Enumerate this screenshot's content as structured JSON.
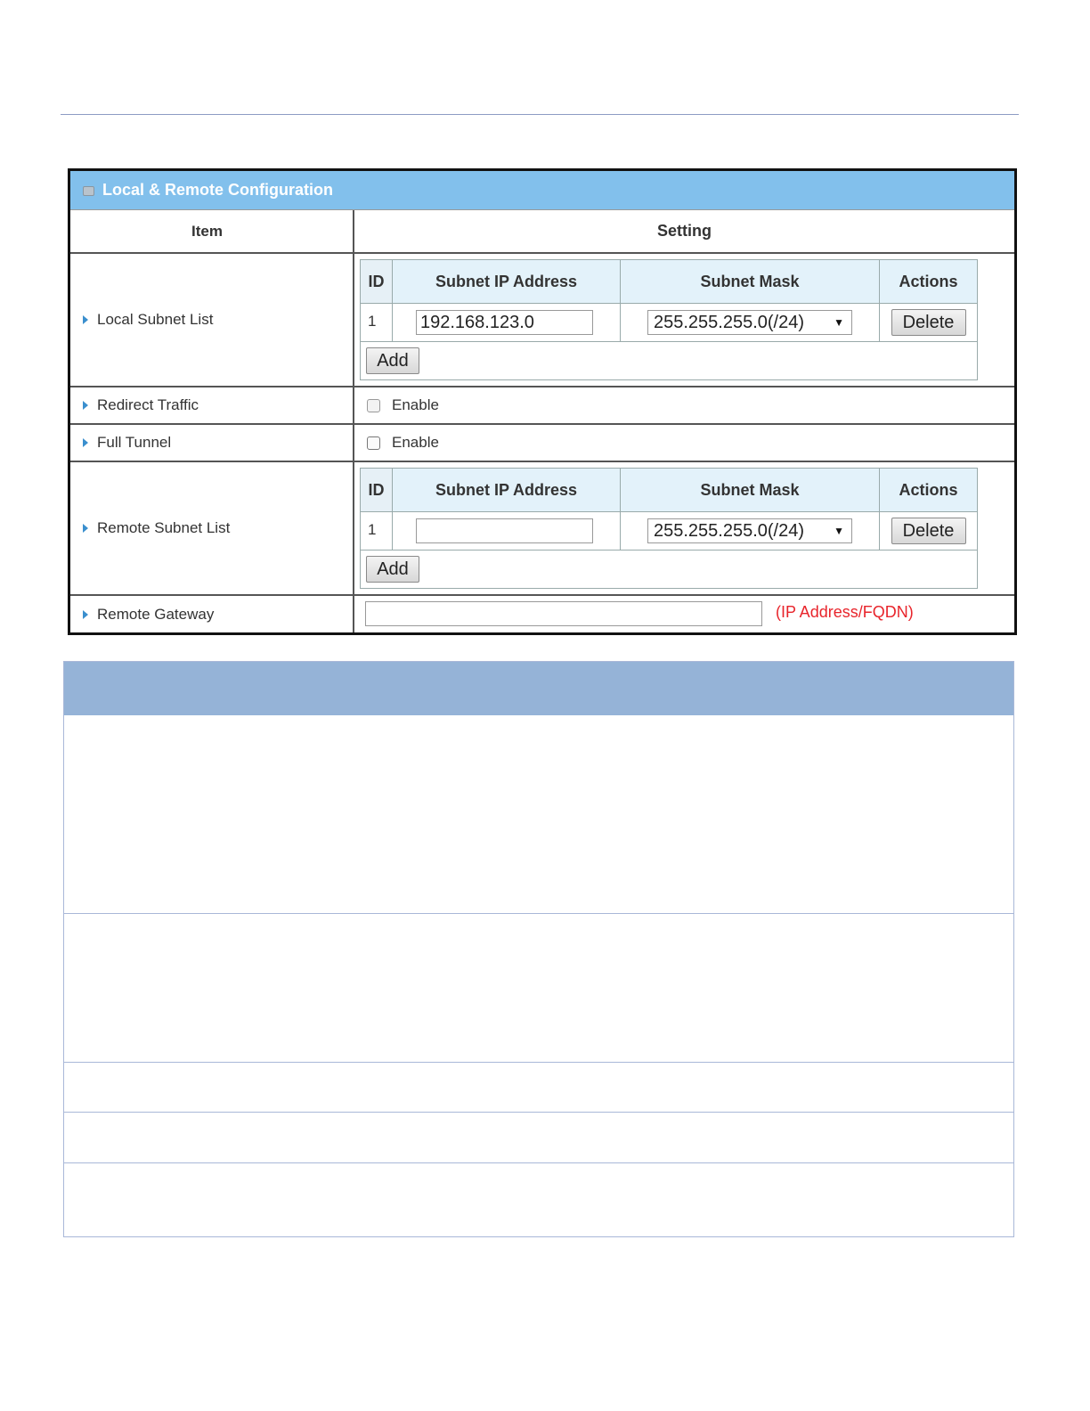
{
  "panel": {
    "title": "Local & Remote Configuration",
    "header_item": "Item",
    "header_setting": "Setting"
  },
  "subnet_columns": {
    "id": "ID",
    "ip": "Subnet IP Address",
    "mask": "Subnet Mask",
    "actions": "Actions"
  },
  "local_subnet": {
    "label": "Local Subnet List",
    "rows": [
      {
        "id": "1",
        "ip": "192.168.123.0",
        "mask": "255.255.255.0(/24)",
        "action": "Delete"
      }
    ],
    "add_label": "Add"
  },
  "redirect_traffic": {
    "label": "Redirect Traffic",
    "enable_label": "Enable",
    "checked": false,
    "disabled": true
  },
  "full_tunnel": {
    "label": "Full Tunnel",
    "enable_label": "Enable",
    "checked": false
  },
  "remote_subnet": {
    "label": "Remote Subnet List",
    "rows": [
      {
        "id": "1",
        "ip": "",
        "mask": "255.255.255.0(/24)",
        "action": "Delete"
      }
    ],
    "add_label": "Add"
  },
  "remote_gateway": {
    "label": "Remote Gateway",
    "value": "",
    "hint": "(IP Address/FQDN)"
  },
  "colors": {
    "header_bg": "#82c0ec",
    "hint": "#e8242b",
    "desc_header": "#95b3d7"
  }
}
